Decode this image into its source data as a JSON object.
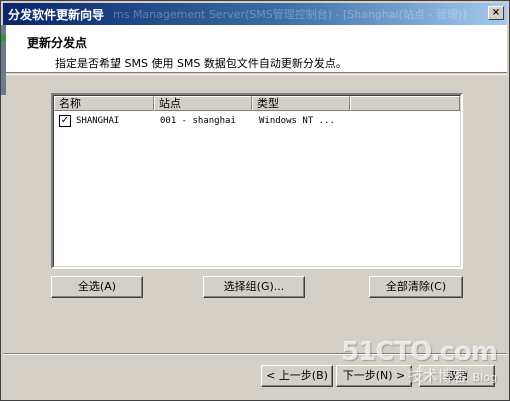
{
  "window": {
    "title": "分发软件更新向导",
    "background_title": "ms Management Server(SMS管理控制台) - [Shanghai(站点 - 管理)]",
    "close_label": "×"
  },
  "header": {
    "title": "更新分发点",
    "subtitle": "指定是否希望 SMS 使用 SMS 数据包文件自动更新分发点。"
  },
  "list": {
    "columns": [
      "名称",
      "站点",
      "类型",
      ""
    ],
    "rows": [
      {
        "checked": true,
        "check_glyph": "✓",
        "name": "SHANGHAI",
        "site": "001 - shanghai",
        "type": "Windows NT ..."
      }
    ]
  },
  "buttons": {
    "select_all": "全选(A)",
    "select_group": "选择组(G)...",
    "clear_all": "全部清除(C)",
    "back": "< 上一步(B)",
    "next": "下一步(N) >",
    "cancel": "取消"
  },
  "watermark": {
    "site": "51CTO.com",
    "tagline": "技术博客",
    "tagline_suffix": "Blog"
  },
  "colors": {
    "titlebar_start": "#0a246a",
    "titlebar_end": "#a6caf0",
    "face": "#d4d0c8"
  }
}
